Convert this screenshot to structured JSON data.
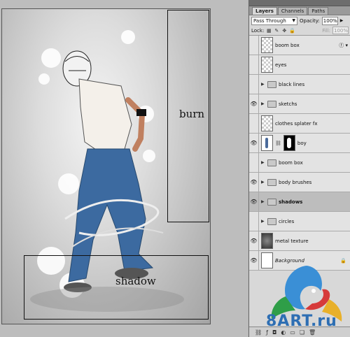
{
  "canvas": {
    "annotations": {
      "burn_label": "burn",
      "shadow_label": "shadow"
    }
  },
  "layers_panel": {
    "tabs": [
      {
        "label": "Layers",
        "active": true
      },
      {
        "label": "Channels",
        "active": false
      },
      {
        "label": "Paths",
        "active": false
      }
    ],
    "blend_mode": "Pass Through",
    "opacity_label": "Opacity:",
    "opacity_value": "100%",
    "lock_label": "Lock:",
    "fill_label": "Fill:",
    "fill_value": "100%",
    "layers": [
      {
        "name": "boom box",
        "visible": false,
        "type": "layer",
        "fx": true
      },
      {
        "name": "eyes",
        "visible": false,
        "type": "layer"
      },
      {
        "name": "black lines",
        "visible": false,
        "type": "group"
      },
      {
        "name": "sketchs",
        "visible": true,
        "type": "group"
      },
      {
        "name": "clothes splater fx",
        "visible": false,
        "type": "layer"
      },
      {
        "name": "boy",
        "visible": true,
        "type": "layer-mask"
      },
      {
        "name": "boom box",
        "visible": false,
        "type": "group"
      },
      {
        "name": "body brushes",
        "visible": true,
        "type": "group"
      },
      {
        "name": "shadows",
        "visible": true,
        "type": "group",
        "selected": true
      },
      {
        "name": "circles",
        "visible": false,
        "type": "group"
      },
      {
        "name": "metal texture",
        "visible": true,
        "type": "layer"
      },
      {
        "name": "Background",
        "visible": true,
        "type": "background",
        "locked": true
      }
    ]
  },
  "watermark": {
    "text": "8ART.ru"
  },
  "colors": {
    "panel_bg": "#d8d8d8",
    "selected_layer": "#bdbdbd",
    "watermark_blue": "#2d6eb3"
  }
}
